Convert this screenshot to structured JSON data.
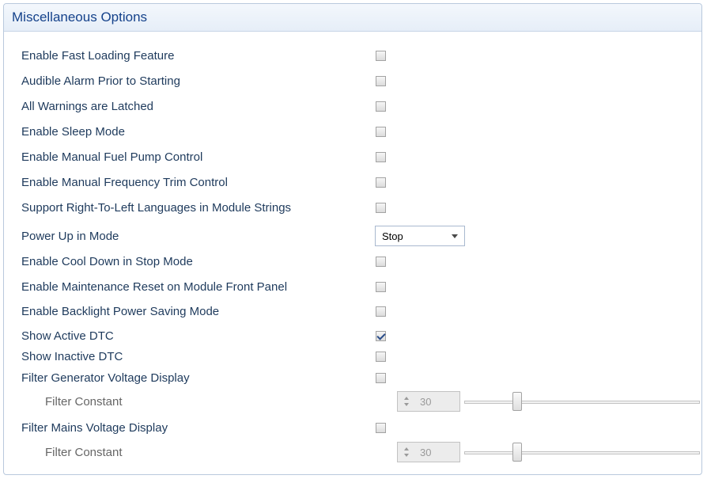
{
  "panel": {
    "title": "Miscellaneous Options"
  },
  "options": [
    {
      "label": "Enable Fast Loading Feature",
      "checked": false
    },
    {
      "label": "Audible Alarm Prior to Starting",
      "checked": false
    },
    {
      "label": "All Warnings are Latched",
      "checked": false
    },
    {
      "label": "Enable Sleep Mode",
      "checked": false
    },
    {
      "label": "Enable Manual Fuel Pump Control",
      "checked": false
    },
    {
      "label": "Enable Manual Frequency Trim Control",
      "checked": false
    },
    {
      "label": "Support Right-To-Left Languages in Module Strings",
      "checked": false
    },
    {
      "label": "Power Up in Mode",
      "select_value": "Stop"
    },
    {
      "label": "Enable Cool Down in Stop Mode",
      "checked": false
    },
    {
      "label": "Enable Maintenance Reset on Module Front Panel",
      "checked": false
    },
    {
      "label": "Enable Backlight Power Saving Mode",
      "checked": false
    },
    {
      "label": "Show Active DTC",
      "checked": true
    },
    {
      "label": "Show Inactive DTC",
      "checked": false
    },
    {
      "label": "Filter Generator Voltage Display",
      "checked": false
    },
    {
      "label": "Filter Constant",
      "value": "30",
      "slider_fraction": 0.2,
      "disabled": true
    },
    {
      "label": "Filter Mains Voltage Display",
      "checked": false
    },
    {
      "label": "Filter Constant",
      "value": "30",
      "slider_fraction": 0.2,
      "disabled": true
    }
  ]
}
